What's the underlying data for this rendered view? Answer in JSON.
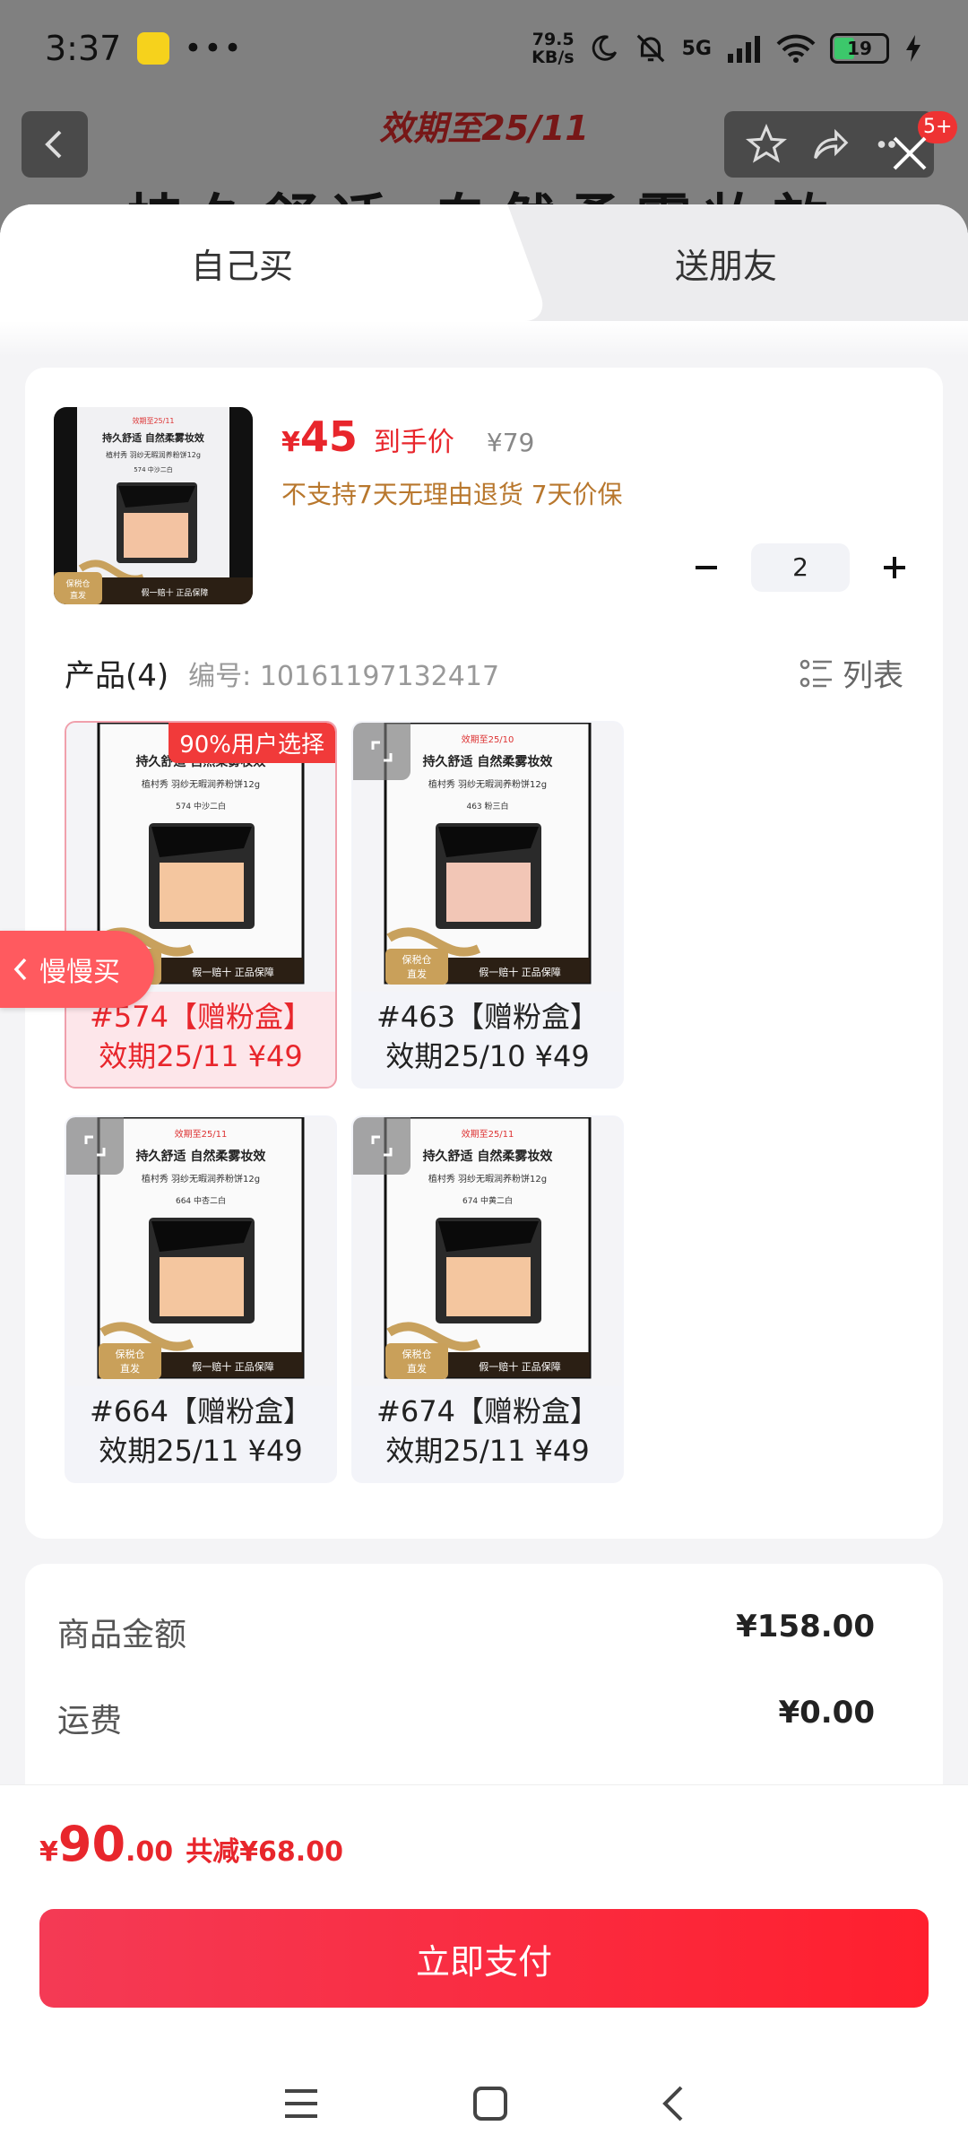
{
  "status_bar": {
    "time": "3:37",
    "dots": "•••",
    "netspeed_value": "79.5",
    "netspeed_unit": "KB/s",
    "network": "5G",
    "battery": "19"
  },
  "background": {
    "promo_text": "效期至25/11",
    "title_text": "持久舒适 自然柔雾妆效",
    "badge_count": "5+"
  },
  "tabs": [
    {
      "label": "自己买",
      "active": true
    },
    {
      "label": "送朋友",
      "active": false
    }
  ],
  "product": {
    "price_symbol": "¥",
    "price": "45",
    "price_label": "到手价",
    "original_price": "¥79",
    "policy": "不支持7天无理由退货  7天价保",
    "quantity": "2",
    "thumb_texts": {
      "top_tag": "效期至25/11",
      "headline": "持久舒适  自然柔雾妆效",
      "sub": "植村秀  羽纱无暇润养粉饼12g",
      "shade": "574 中沙二白",
      "bonded": "保税仓",
      "direct": "直发",
      "guarantee": "假一赔十  正品保障"
    }
  },
  "products": {
    "title": "产品(4)",
    "code": "编号: 10161197132417",
    "list_label": "列表",
    "badge": "90%用户选择",
    "items": [
      {
        "line1": "#574【赠粉盒】",
        "line2": "效期25/11 ¥49",
        "shade": "574 中沙二白",
        "tag": "效期至25/11",
        "selected": true
      },
      {
        "line1": "#463【赠粉盒】",
        "line2": "效期25/10 ¥49",
        "shade": "463 粉三白",
        "tag": "效期至25/10",
        "selected": false
      },
      {
        "line1": "#664【赠粉盒】",
        "line2": "效期25/11 ¥49",
        "shade": "664 中杏二白",
        "tag": "效期至25/11",
        "selected": false
      },
      {
        "line1": "#674【赠粉盒】",
        "line2": "效期25/11 ¥49",
        "shade": "674 中黄二白",
        "tag": "效期至25/11",
        "selected": false
      }
    ]
  },
  "slow_buy": "慢慢买",
  "summary": {
    "goods_label": "商品金额",
    "goods_value": "¥158.00",
    "shipping_label": "运费",
    "shipping_value": "¥0.00"
  },
  "footer": {
    "total_symbol": "¥",
    "total_int": "90",
    "total_dec": ".00",
    "saved": "共减¥68.00",
    "pay_label": "立即支付"
  },
  "colors": {
    "accent": "#e8262c",
    "policy": "#b8772d",
    "pay_start": "#f43a55",
    "pay_end": "#ff1f2e"
  }
}
